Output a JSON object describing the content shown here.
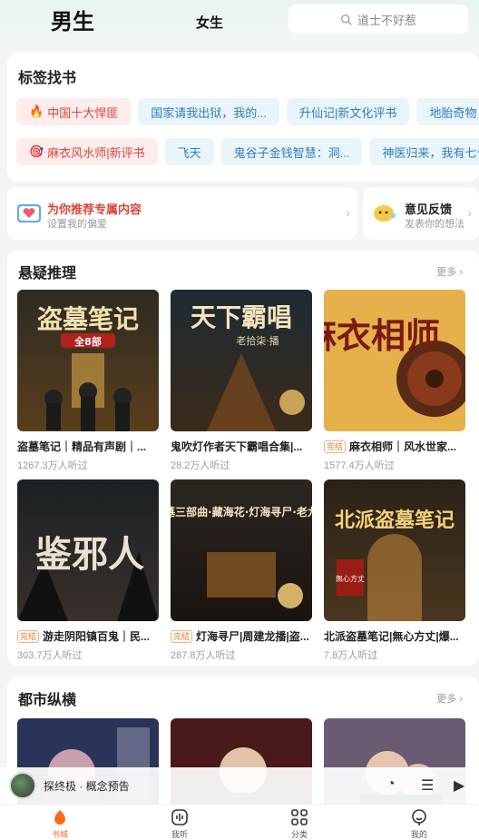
{
  "header": {
    "tab_male": "男生",
    "tab_female": "女生",
    "search_placeholder": "道士不好惹"
  },
  "tags": {
    "title": "标签找书",
    "row1": [
      "中国十大悍匪",
      "国家请我出狱，我的...",
      "升仙记|新文化评书",
      "地胎奇物"
    ],
    "row2": [
      "麻衣风水师|新评书",
      "飞天",
      "鬼谷子金钱智慧：洞...",
      "神医归来，我有七个..."
    ]
  },
  "recommend": {
    "title": "为你推荐专属内容",
    "subtitle": "设置我的偏爱",
    "feedback_title": "意见反馈",
    "feedback_subtitle": "发表你的想法"
  },
  "section_mystery": {
    "title": "悬疑推理",
    "more": "更多",
    "books": [
      {
        "title": "盗墓笔记｜精品有声剧｜...",
        "listens": "1267.3万人听过",
        "badge": "",
        "cover_text": "盗墓笔记",
        "cover_sub": "全8部"
      },
      {
        "title": "鬼吹灯作者天下霸唱合集|...",
        "listens": "28.2万人听过",
        "badge": "",
        "cover_text": "天下霸唱",
        "cover_sub": "老拾柒·播"
      },
      {
        "title": "麻衣相师｜风水世家...",
        "listens": "1577.4万人听过",
        "badge": "完结",
        "cover_text": "麻衣相师",
        "cover_sub": ""
      },
      {
        "title": "游走阴阳镇百鬼｜民...",
        "listens": "303.7万人听过",
        "badge": "完结",
        "cover_text": "鉴邪人",
        "cover_sub": ""
      },
      {
        "title": "灯海寻尸|周建龙播|盗...",
        "listens": "287.8万人听过",
        "badge": "完结",
        "cover_text": "盗墓三部曲·藏海花·灯海寻尸·老九门",
        "cover_sub": ""
      },
      {
        "title": "北派盗墓笔记|無心方丈|爆...",
        "listens": "7.8万人听过",
        "badge": "",
        "cover_text": "北派盗墓笔记",
        "cover_sub": "無心方丈"
      }
    ]
  },
  "section_city": {
    "title": "都市纵横",
    "more": "更多"
  },
  "player": {
    "title": "探终极 · 概念预告"
  },
  "nav": {
    "items": [
      "书城",
      "我听",
      "分类",
      "我的"
    ]
  }
}
